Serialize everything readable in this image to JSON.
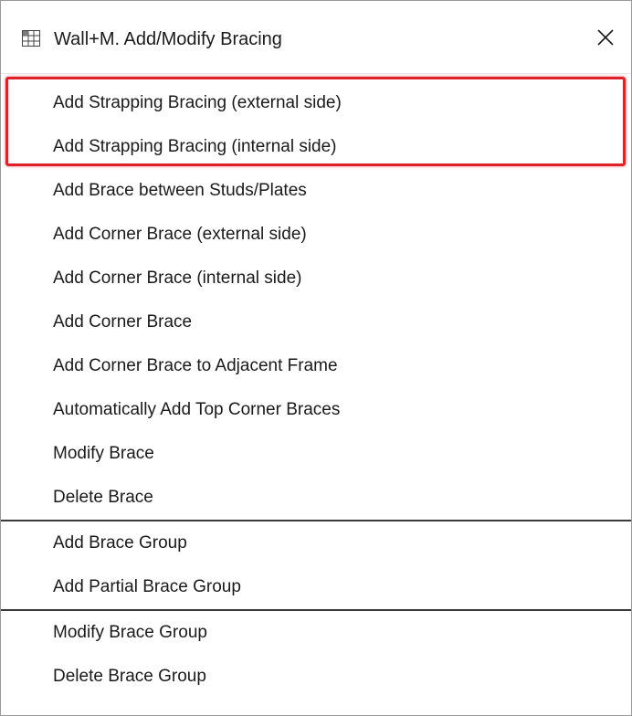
{
  "window": {
    "title": "Wall+M. Add/Modify Bracing",
    "app_icon": "grid-table-icon",
    "close_icon": "close-icon",
    "close_glyph": "✕"
  },
  "menu": {
    "group1": [
      {
        "label": "Add Strapping Bracing (external side)"
      },
      {
        "label": "Add Strapping Bracing (internal side)"
      },
      {
        "label": "Add Brace between Studs/Plates"
      },
      {
        "label": "Add Corner Brace (external side)"
      },
      {
        "label": "Add Corner Brace (internal side)"
      },
      {
        "label": "Add Corner Brace"
      },
      {
        "label": "Add Corner Brace to Adjacent Frame"
      },
      {
        "label": "Automatically Add Top Corner Braces"
      },
      {
        "label": "Modify Brace"
      },
      {
        "label": "Delete Brace"
      }
    ],
    "group2": [
      {
        "label": "Add Brace Group"
      },
      {
        "label": "Add Partial Brace Group"
      }
    ],
    "group3": [
      {
        "label": "Modify Brace Group"
      },
      {
        "label": "Delete Brace Group"
      }
    ]
  },
  "colors": {
    "highlight_border": "#e0212a",
    "separator": "#3a3a3a",
    "text": "#1a1a1a"
  }
}
